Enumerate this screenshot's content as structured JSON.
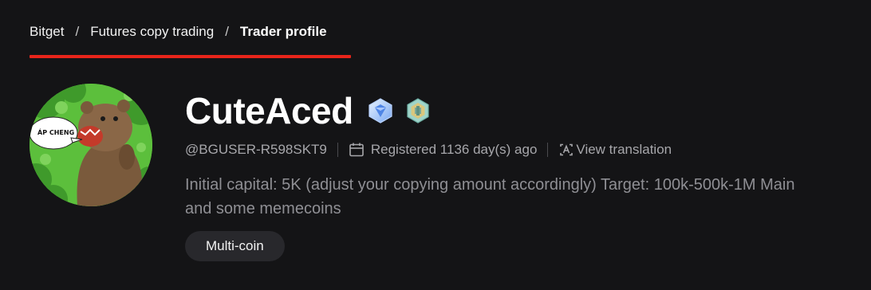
{
  "breadcrumb": {
    "items": [
      {
        "label": "Bitget"
      },
      {
        "label": "Futures copy trading"
      },
      {
        "label": "Trader profile"
      }
    ],
    "separator": "/"
  },
  "profile": {
    "name": "CuteAced",
    "handle": "@BGUSER-R598SKT9",
    "registered": "Registered 1136 day(s) ago",
    "translate_label": "View translation",
    "bio_lines": [
      "Initial capital: 5K (adjust your copying amount accordingly) Target: 100k-500k-1M Main",
      "and some memecoins"
    ],
    "tags": [
      "Multi-coin"
    ],
    "avatar_caption": "ÁP CHENG",
    "badges": [
      "diamond-badge-icon",
      "hexagon-level-badge-icon"
    ]
  },
  "colors": {
    "background": "#141416",
    "accent_underline": "#e8241a",
    "avatar_bg": "#5cbf3c",
    "muted_text": "#a7a7ab",
    "tag_bg": "#28282c"
  }
}
